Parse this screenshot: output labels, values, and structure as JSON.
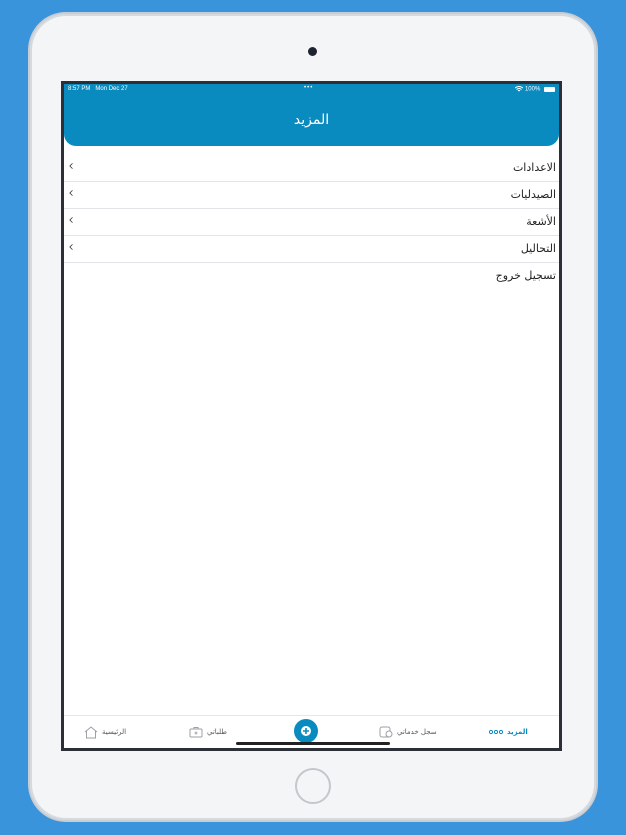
{
  "status_bar": {
    "time": "8:57 PM",
    "date": "Mon Dec 27",
    "dots": "•••",
    "battery": "100%"
  },
  "header": {
    "title": "المزيد"
  },
  "menu": {
    "items": [
      {
        "label": "الاعدادات"
      },
      {
        "label": "الصيدليات"
      },
      {
        "label": "الأشعة"
      },
      {
        "label": "التحاليل"
      },
      {
        "label": "تسجيل خروج"
      }
    ]
  },
  "tab_bar": {
    "more": "المزيد",
    "services": "سجل خدماتي",
    "requests": "طلباتي",
    "home": "الرئيسية"
  },
  "colors": {
    "primary": "#0a8bc0",
    "background": "#3a94dc"
  },
  "icons": {
    "add": "plus-circle-icon",
    "home": "house-icon",
    "requests": "briefcase-icon",
    "services": "history-icon",
    "more": "dots-icon"
  }
}
